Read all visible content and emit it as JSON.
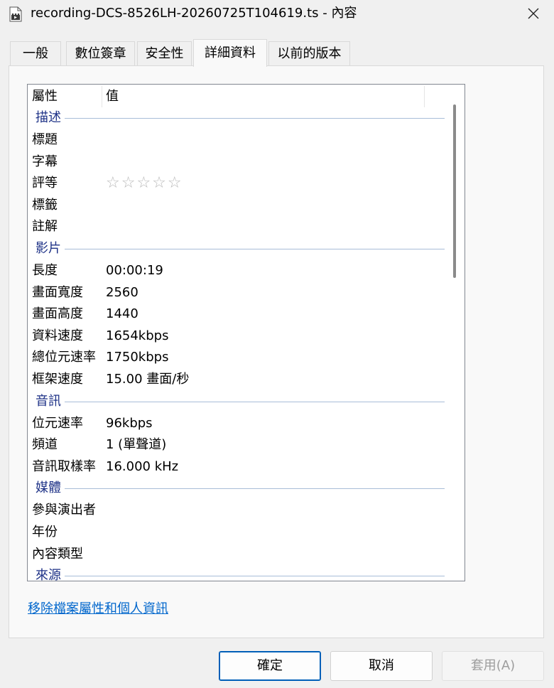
{
  "window": {
    "title": "recording-DCS-8526LH-20260725T104619.ts - 內容",
    "close_icon": "close-icon",
    "app_icon": "video-file-icon"
  },
  "tabs": [
    {
      "label": "一般"
    },
    {
      "label": "數位簽章"
    },
    {
      "label": "安全性"
    },
    {
      "label": "詳細資料",
      "active": true
    },
    {
      "label": "以前的版本"
    }
  ],
  "list": {
    "header": {
      "property": "屬性",
      "value": "值"
    },
    "groups": [
      {
        "label": "描述",
        "rows": [
          {
            "k": "標題",
            "v": ""
          },
          {
            "k": "字幕",
            "v": ""
          },
          {
            "k": "評等",
            "v": "☆☆☆☆☆",
            "stars": 0
          },
          {
            "k": "標籤",
            "v": ""
          },
          {
            "k": "註解",
            "v": ""
          }
        ]
      },
      {
        "label": "影片",
        "rows": [
          {
            "k": "長度",
            "v": "00:00:19"
          },
          {
            "k": "畫面寬度",
            "v": "2560"
          },
          {
            "k": "畫面高度",
            "v": "1440"
          },
          {
            "k": "資料速度",
            "v": "1654kbps"
          },
          {
            "k": "總位元速率",
            "v": "1750kbps"
          },
          {
            "k": "框架速度",
            "v": "15.00 畫面/秒"
          }
        ]
      },
      {
        "label": "音訊",
        "rows": [
          {
            "k": "位元速率",
            "v": "96kbps"
          },
          {
            "k": "頻道",
            "v": "1 (單聲道)"
          },
          {
            "k": "音訊取樣率",
            "v": "16.000 kHz"
          }
        ]
      },
      {
        "label": "媒體",
        "rows": [
          {
            "k": "參與演出者",
            "v": ""
          },
          {
            "k": "年份",
            "v": ""
          },
          {
            "k": "內容類型",
            "v": ""
          }
        ]
      },
      {
        "label": "來源",
        "rows": []
      }
    ]
  },
  "remove_link": "移除檔案屬性和個人資訊",
  "buttons": {
    "ok": "確定",
    "cancel": "取消",
    "apply": "套用(A)"
  }
}
